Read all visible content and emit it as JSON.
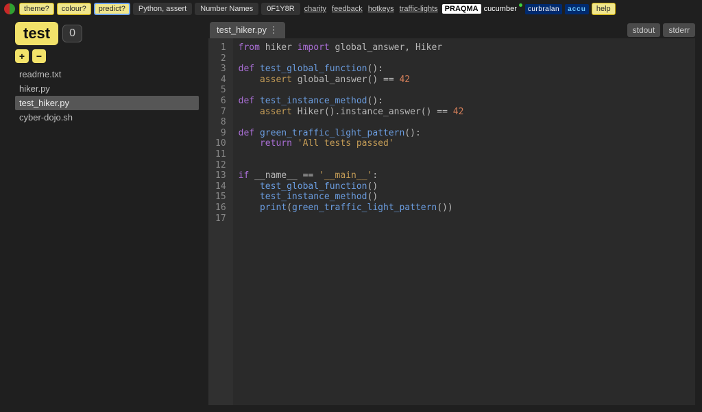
{
  "topbar": {
    "theme": "theme?",
    "colour": "colour?",
    "predict": "predict?",
    "lang": "Python, assert",
    "exercise": "Number Names",
    "session": "0F1Y8R",
    "charity": "charity",
    "feedback": "feedback",
    "hotkeys": "hotkeys",
    "traffic": "traffic-lights",
    "praqma": "PRAQMA",
    "cucumber": "cucumber",
    "curbralan": "curbralan",
    "accu": "accu",
    "help": "help"
  },
  "sidebar": {
    "test_label": "test",
    "counter": "0",
    "plus": "+",
    "minus": "−",
    "files": [
      "readme.txt",
      "hiker.py",
      "test_hiker.py",
      "cyber-dojo.sh"
    ],
    "selected_index": 2
  },
  "editor": {
    "tab": "test_hiker.py ⋮",
    "stdout": "stdout",
    "stderr": "stderr",
    "lines": 17,
    "code_tokens": [
      [
        [
          "kw",
          "from"
        ],
        [
          "pn",
          " hiker "
        ],
        [
          "kw",
          "import"
        ],
        [
          "pn",
          " global_answer, Hiker"
        ]
      ],
      [],
      [
        [
          "kw",
          "def"
        ],
        [
          "pn",
          " "
        ],
        [
          "fn",
          "test_global_function"
        ],
        [
          "pn",
          "():"
        ]
      ],
      [
        [
          "pn",
          "    "
        ],
        [
          "kw2",
          "assert"
        ],
        [
          "pn",
          " global_answer() "
        ],
        [
          "op",
          "=="
        ],
        [
          "pn",
          " "
        ],
        [
          "num",
          "42"
        ]
      ],
      [],
      [
        [
          "kw",
          "def"
        ],
        [
          "pn",
          " "
        ],
        [
          "fn",
          "test_instance_method"
        ],
        [
          "pn",
          "():"
        ]
      ],
      [
        [
          "pn",
          "    "
        ],
        [
          "kw2",
          "assert"
        ],
        [
          "pn",
          " Hiker().instance_answer() "
        ],
        [
          "op",
          "=="
        ],
        [
          "pn",
          " "
        ],
        [
          "num",
          "42"
        ]
      ],
      [],
      [
        [
          "kw",
          "def"
        ],
        [
          "pn",
          " "
        ],
        [
          "fn",
          "green_traffic_light_pattern"
        ],
        [
          "pn",
          "():"
        ]
      ],
      [
        [
          "pn",
          "    "
        ],
        [
          "kw",
          "return"
        ],
        [
          "pn",
          " "
        ],
        [
          "str",
          "'All tests passed'"
        ]
      ],
      [],
      [],
      [
        [
          "kw",
          "if"
        ],
        [
          "pn",
          " __name__ "
        ],
        [
          "op",
          "=="
        ],
        [
          "pn",
          " "
        ],
        [
          "str",
          "'__main__'"
        ],
        [
          "pn",
          ":"
        ]
      ],
      [
        [
          "pn",
          "    "
        ],
        [
          "fn",
          "test_global_function"
        ],
        [
          "pn",
          "()"
        ]
      ],
      [
        [
          "pn",
          "    "
        ],
        [
          "fn",
          "test_instance_method"
        ],
        [
          "pn",
          "()"
        ]
      ],
      [
        [
          "pn",
          "    "
        ],
        [
          "fn",
          "print"
        ],
        [
          "pn",
          "("
        ],
        [
          "fn",
          "green_traffic_light_pattern"
        ],
        [
          "pn",
          "())"
        ]
      ],
      []
    ]
  }
}
